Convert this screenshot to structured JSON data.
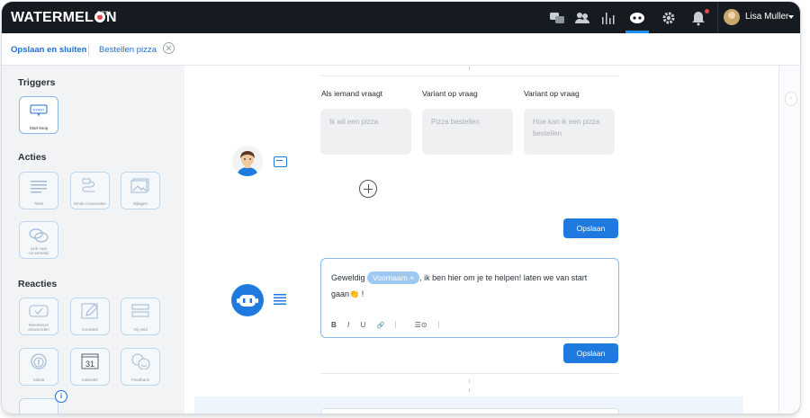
{
  "app": {
    "logo_text_a": "WATERMEL",
    "logo_text_b": "N",
    "beta": "BETA"
  },
  "topnav": {
    "icons": [
      "chat-bubbles-icon",
      "users-icon",
      "bar-chart-icon",
      "bot-icon",
      "gear-icon",
      "bell-icon"
    ],
    "active": "bot-icon",
    "user_name": "Lisa Muller"
  },
  "subbar": {
    "save_close": "Opslaan en sluiten",
    "flow_name": "Bestellen pizza"
  },
  "sidebar": {
    "triggers_title": "Triggers",
    "triggers": [
      {
        "label": "Start knop",
        "icon": "start-icon"
      }
    ],
    "actions_title": "Acties",
    "actions": [
      {
        "label": "Tekst",
        "icon": "text-icon"
      },
      {
        "label": "Einde conversatie",
        "icon": "end-conversation-icon"
      },
      {
        "label": "Bijlagen",
        "icon": "attachment-icon"
      },
      {
        "label": "Link naar conversatie",
        "icon": "link-icon"
      }
    ],
    "reactions_title": "Reacties",
    "reactions": [
      {
        "label": "Meerkeuze antwoorden",
        "icon": "multiple-choice-icon"
      },
      {
        "label": "Invulveld",
        "icon": "input-field-icon"
      },
      {
        "label": "Vrij veld",
        "icon": "free-field-icon"
      },
      {
        "label": "Valuta",
        "icon": "currency-icon"
      },
      {
        "label": "Kalender",
        "icon": "calendar-icon"
      },
      {
        "label": "Feedback",
        "icon": "feedback-icon"
      }
    ],
    "calendar_day": "31",
    "info_badge": "i"
  },
  "question_block": {
    "columns": [
      "Als iemand vraagt",
      "Variant op vraag",
      "Variant op vraag"
    ],
    "placeholders": [
      "Ik wil een pizza",
      "Pizza bestellen",
      "Hoe kan ik een pizza bestellen"
    ],
    "save": "Opslaan"
  },
  "answer_block": {
    "text_before": "Geweldig",
    "chip": "Voornaam",
    "chip_remove": "×",
    "text_after": ", ik ben hier om je te helpen! laten we van start gaan",
    "emoji": "👏",
    "text_end": " !",
    "toolbar": {
      "bold": "B",
      "italic": "I",
      "underline": "U",
      "link": "🔗",
      "variable": "☰⊙"
    },
    "save": "Opslaan"
  }
}
